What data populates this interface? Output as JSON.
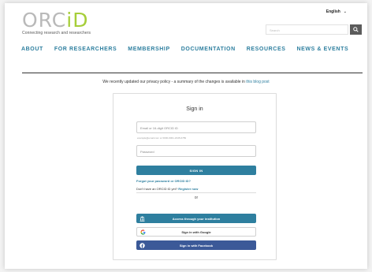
{
  "header": {
    "language": "English",
    "logo": {
      "prefix": "ORC",
      "suffix": "iD"
    },
    "tagline": "Connecting research and researchers",
    "search_placeholder": "Search"
  },
  "nav": {
    "items": [
      "ABOUT",
      "FOR RESEARCHERS",
      "MEMBERSHIP",
      "DOCUMENTATION",
      "RESOURCES",
      "NEWS & EVENTS"
    ]
  },
  "notice": {
    "text": "We recently updated our privacy policy - a summary of the changes is available in",
    "link": "this blog post"
  },
  "signin": {
    "title": "Sign in",
    "email_placeholder": "Email or 16-digit ORCID iD",
    "email_hint": "example@email.com or 0000-0001-2345-6789",
    "password_placeholder": "Password",
    "signin_button": "SIGN IN",
    "forgot_link": "Forgot your password or ORCID iD?",
    "register_prefix": "Don't have an ORCID iD yet?",
    "register_link": "Register now",
    "or_text": "or",
    "institution_button": "Access through your institution",
    "google_button": "Sign in with Google",
    "facebook_button": "Sign in with Facebook"
  },
  "colors": {
    "accent": "#2e7f9f",
    "logo_green": "#a6ce39",
    "facebook": "#3b5998"
  }
}
